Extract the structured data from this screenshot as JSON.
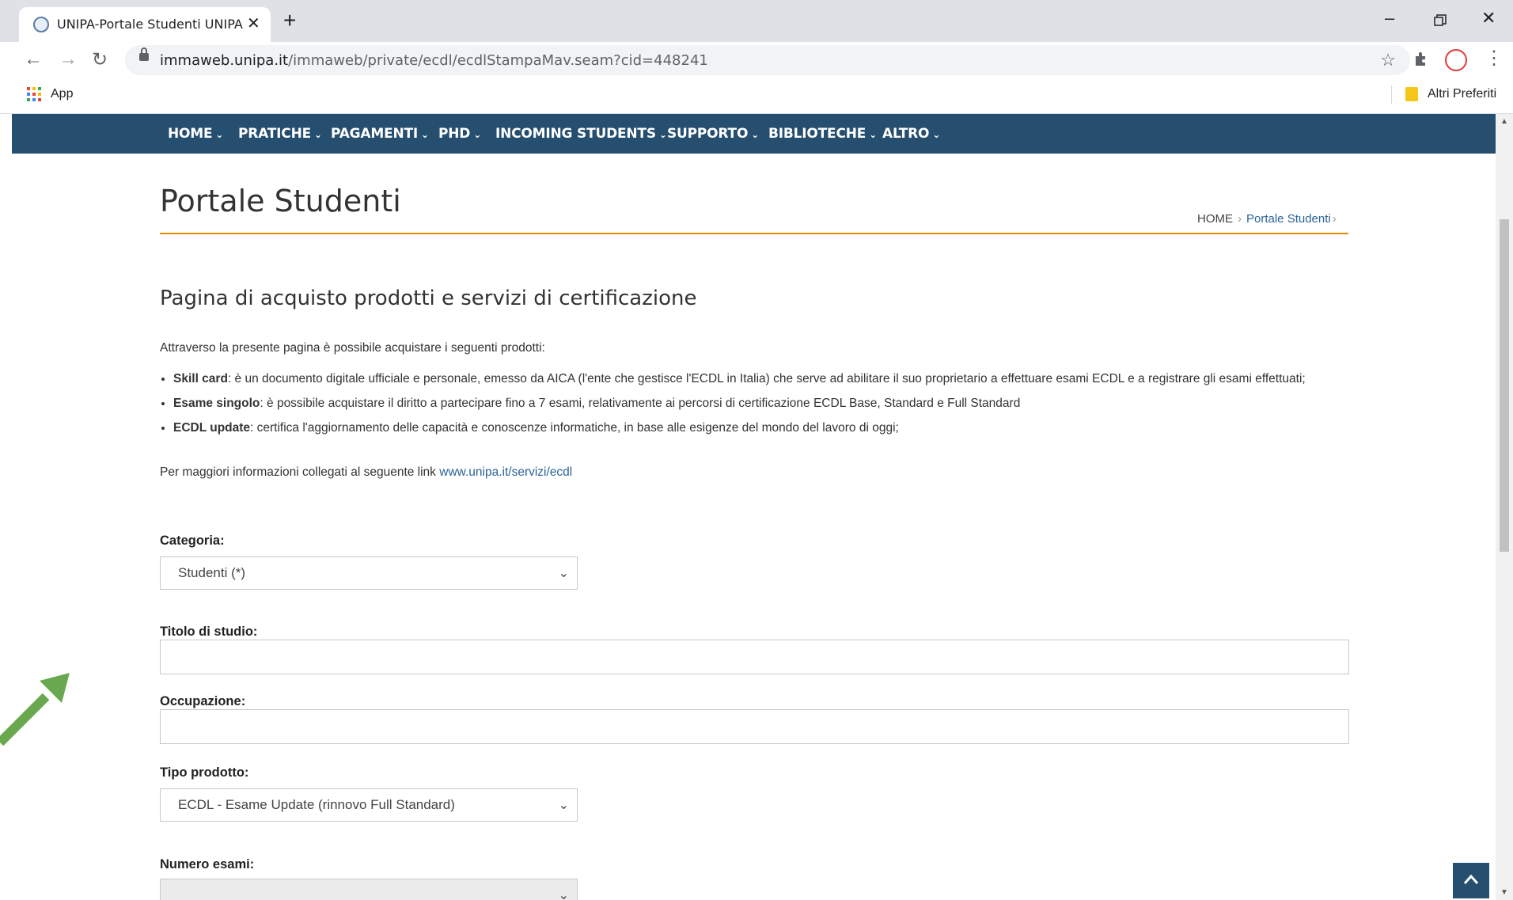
{
  "browser": {
    "tab_title": "UNIPA-Portale Studenti UNIPA",
    "url_host": "immaweb.unipa.it",
    "url_path": "/immaweb/private/ecdl/ecdlStampaMav.seam?cid=448241",
    "apps_label": "App",
    "other_bookmarks": "Altri Preferiti"
  },
  "nav": {
    "items": [
      "HOME",
      "PRATICHE",
      "PAGAMENTI",
      "PHD",
      "INCOMING STUDENTS",
      "SUPPORTO",
      "BIBLIOTECHE",
      "ALTRO"
    ]
  },
  "page": {
    "title": "Portale Studenti",
    "breadcrumb": {
      "home": "HOME",
      "current": "Portale Studenti"
    },
    "section_title": "Pagina di acquisto prodotti e servizi di certificazione",
    "intro": "Attraverso la presente pagina è possibile acquistare i seguenti prodotti:",
    "bullets": [
      {
        "term": "Skill card",
        "text": ": è un documento digitale ufficiale e personale, emesso da AICA (l'ente che gestisce l'ECDL in Italia) che serve ad abilitare il suo proprietario a effettuare esami ECDL e a registrare gli esami effettuati;"
      },
      {
        "term": "Esame singolo",
        "text": ": è possibile acquistare il diritto a partecipare fino a 7 esami, relativamente ai percorsi di certificazione ECDL Base, Standard e Full Standard"
      },
      {
        "term": "ECDL update",
        "text": ": certifica l'aggiornamento delle capacità e conoscenze informatiche, in base alle esigenze del mondo del lavoro di oggi;"
      }
    ],
    "more_info_text": "Per maggiori informazioni collegati al seguente link ",
    "more_info_link": "www.unipa.it/servizi/ecdl"
  },
  "form": {
    "categoria_label": "Categoria:",
    "categoria_value": "Studenti (*)",
    "titolo_label": "Titolo di studio:",
    "titolo_value": "",
    "occupazione_label": "Occupazione:",
    "occupazione_value": "",
    "tipo_label": "Tipo prodotto:",
    "tipo_value": "ECDL - Esame Update (rinnovo Full Standard)",
    "numero_label": "Numero esami:",
    "numero_value": ""
  },
  "colors": {
    "nav_bg": "#254e6f",
    "rule": "#e68a00",
    "annotation_arrow": "#6aa84f"
  }
}
